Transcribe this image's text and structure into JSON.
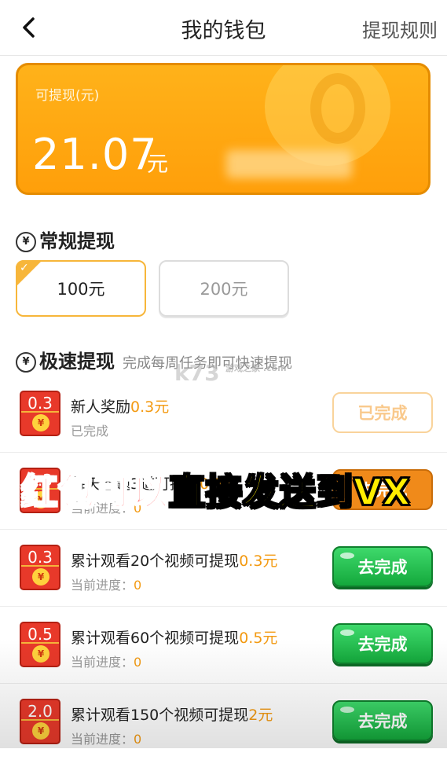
{
  "header": {
    "title": "我的钱包",
    "rules_link": "提现规则",
    "back_icon": "back-arrow-icon"
  },
  "balance": {
    "label": "可提现(元)",
    "amount": "21.07",
    "unit": "元",
    "accent_color": "#ffa812"
  },
  "regular": {
    "title": "常规提现",
    "options": [
      {
        "label": "100元",
        "selected": true
      },
      {
        "label": "200元",
        "selected": false
      }
    ]
  },
  "fast": {
    "title": "极速提现",
    "subtitle": "完成每周任务即可快速提现"
  },
  "tasks": [
    {
      "badge": "0.3",
      "name": "新人奖励",
      "reward": "0.3元",
      "sub_label": "已完成",
      "progress": "",
      "button": "已完成",
      "state": "done"
    },
    {
      "badge": "0.3",
      "name": "每天答题3道可提现",
      "reward": "0.3元",
      "sub_label": "当前进度：",
      "progress": "0",
      "button": "去完成",
      "state": "orange"
    },
    {
      "badge": "0.3",
      "name": "累计观看20个视频可提现",
      "reward": "0.3元",
      "sub_label": "当前进度：",
      "progress": "0",
      "button": "去完成",
      "state": "go"
    },
    {
      "badge": "0.5",
      "name": "累计观看60个视频可提现",
      "reward": "0.5元",
      "sub_label": "当前进度：",
      "progress": "0",
      "button": "去完成",
      "state": "go"
    },
    {
      "badge": "2.0",
      "name": "累计观看150个视频可提现",
      "reward": "2元",
      "sub_label": "当前进度：",
      "progress": "0",
      "button": "去完成",
      "state": "go"
    }
  ],
  "overlay": {
    "part1": "红包可以",
    "part2": "直接发送到VX"
  },
  "watermark": {
    "main": "k73",
    "small": "游戏之家 .com"
  }
}
